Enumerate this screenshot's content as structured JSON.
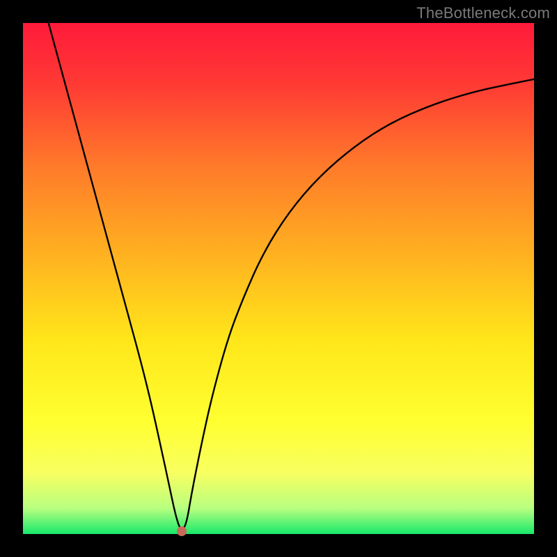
{
  "watermark": "TheBottleneck.com",
  "gradient": {
    "stops": [
      {
        "offset": 0.0,
        "color": "#ff1a3a"
      },
      {
        "offset": 0.12,
        "color": "#ff3a34"
      },
      {
        "offset": 0.28,
        "color": "#ff7a2a"
      },
      {
        "offset": 0.45,
        "color": "#ffb020"
      },
      {
        "offset": 0.62,
        "color": "#ffe61a"
      },
      {
        "offset": 0.78,
        "color": "#ffff30"
      },
      {
        "offset": 0.88,
        "color": "#f8ff60"
      },
      {
        "offset": 0.95,
        "color": "#b8ff80"
      },
      {
        "offset": 1.0,
        "color": "#17e86a"
      }
    ]
  },
  "chart_data": {
    "type": "line",
    "title": "",
    "xlabel": "",
    "ylabel": "",
    "xlim": [
      0,
      100
    ],
    "ylim": [
      0,
      100
    ],
    "series": [
      {
        "name": "bottleneck-curve",
        "x": [
          5,
          8,
          11,
          14,
          17,
          20,
          23,
          25,
          27,
          28.5,
          30,
          31,
          32,
          33,
          35,
          37,
          40,
          43,
          47,
          52,
          58,
          65,
          72,
          80,
          88,
          95,
          100
        ],
        "y": [
          100,
          89,
          78,
          67,
          56,
          45,
          34,
          26,
          17,
          10,
          3,
          0.5,
          2,
          8,
          18,
          27,
          38,
          46,
          55,
          63,
          70,
          76,
          80.5,
          84,
          86.5,
          88,
          89
        ]
      }
    ],
    "marker": {
      "x": 31,
      "y": 0.5,
      "name": "optimal-point"
    }
  }
}
